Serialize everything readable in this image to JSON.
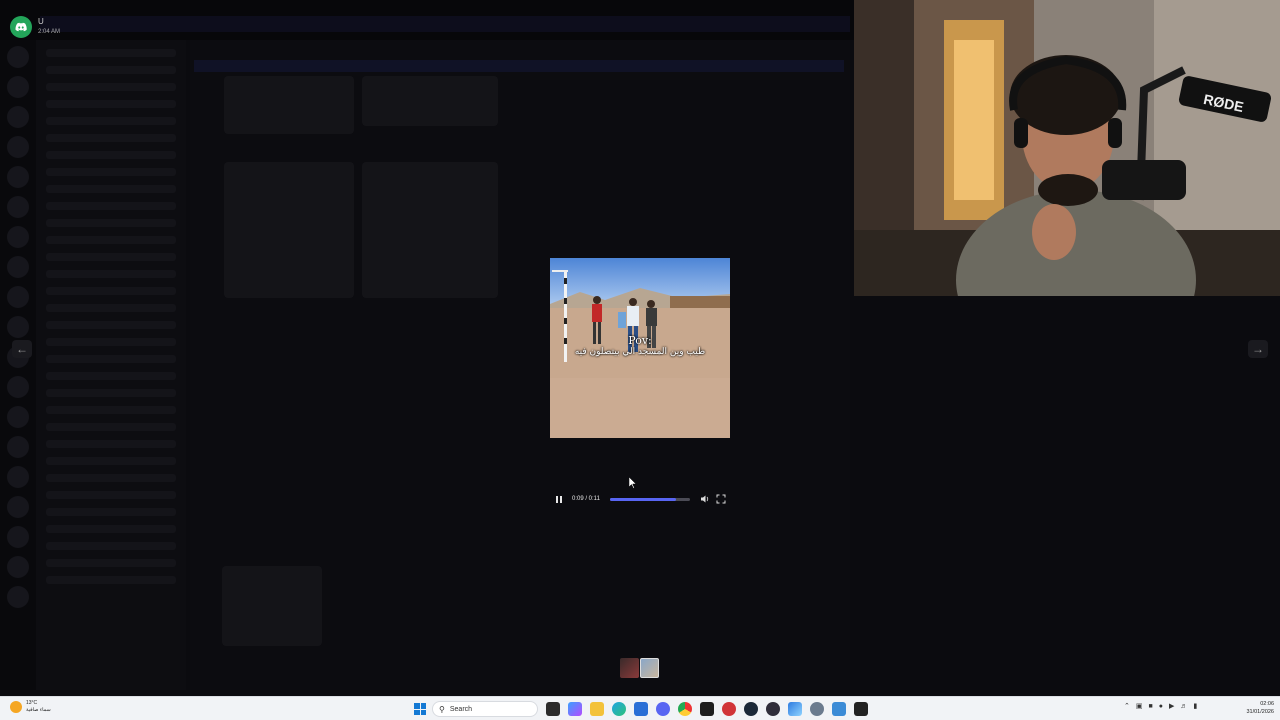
{
  "notification": {
    "app": "U",
    "time": "2:04 AM"
  },
  "player": {
    "caption_line1": "Pov:",
    "caption_line2": "طيب وين المسجد الي بيتصلون فيه",
    "time": "0:09 / 0:11",
    "progress": 0.82,
    "accent_color": "#5865f2"
  },
  "nav": {
    "prev_icon": "arrow-left-icon",
    "next_icon": "arrow-right-icon"
  },
  "webcam": {
    "mic_brand": "RØDE"
  },
  "taskbar": {
    "weather_temp": "13°C",
    "weather_desc": "سماء صافية",
    "search_placeholder": "Search",
    "clock_time": "02:06",
    "clock_date": "31/01/2026",
    "apps": [
      "file-explorer-icon",
      "copilot-icon",
      "folder-icon",
      "edge-icon",
      "store-icon",
      "discord-icon",
      "chrome-icon",
      "terminal-icon",
      "media-icon",
      "steam-icon",
      "obs-icon",
      "photos-icon",
      "settings-icon",
      "app-icon",
      "epic-games-icon"
    ]
  }
}
